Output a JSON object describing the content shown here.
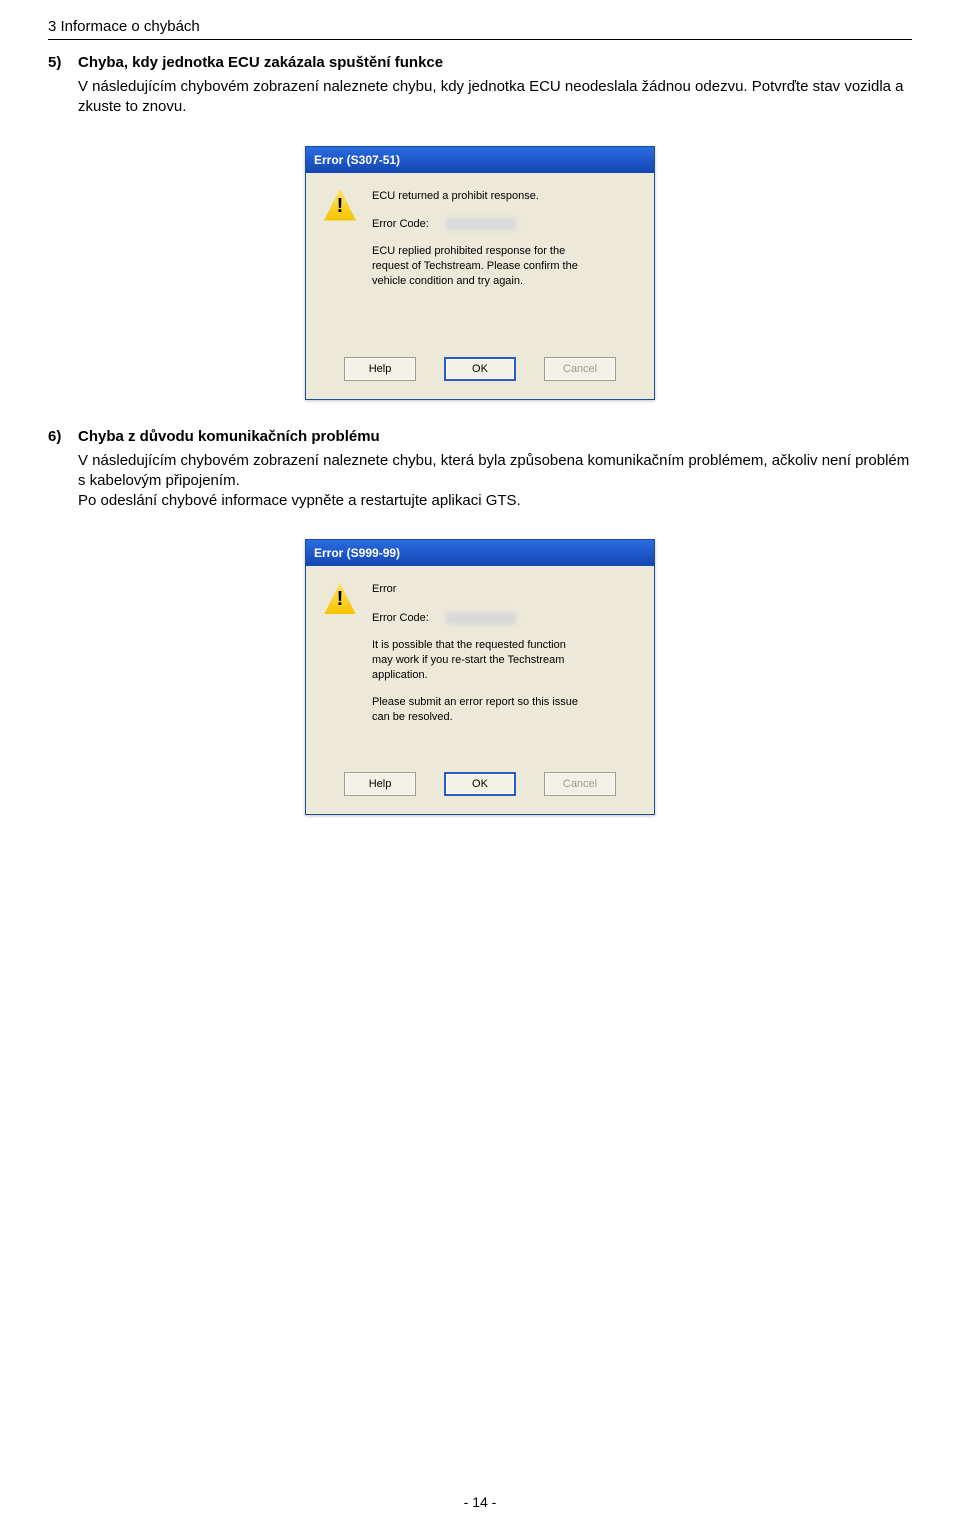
{
  "header": "3 Informace o chybách",
  "section5": {
    "num": "5)",
    "title": "Chyba, kdy jednotka ECU zakázala spuštění funkce",
    "body": "V následujícím chybovém zobrazení naleznete chybu, kdy jednotka ECU neodeslala žádnou odezvu. Potvrďte stav vozidla a zkuste to znovu."
  },
  "dialog1": {
    "title": "Error (S307-51)",
    "msg1": "ECU returned a prohibit response.",
    "codeLabel": "Error Code:",
    "desc": "ECU replied prohibited response for the request of Techstream. Please confirm the vehicle condition and try again.",
    "help": "Help",
    "ok": "OK",
    "cancel": "Cancel"
  },
  "section6": {
    "num": "6)",
    "title": "Chyba z důvodu komunikačních problému",
    "body": "V následujícím chybovém zobrazení naleznete chybu, která byla způsobena komunikačním problémem, ačkoliv není problém s kabelovým připojením.\nPo odeslání chybové informace vypněte a restartujte aplikaci GTS."
  },
  "dialog2": {
    "title": "Error (S999-99)",
    "msg1": "Error",
    "codeLabel": "Error Code:",
    "desc1": "It is possible that the requested function may work if you re-start the Techstream application.",
    "desc2": "Please submit an error report so this issue can be resolved.",
    "help": "Help",
    "ok": "OK",
    "cancel": "Cancel"
  },
  "footer": "- 14 -"
}
